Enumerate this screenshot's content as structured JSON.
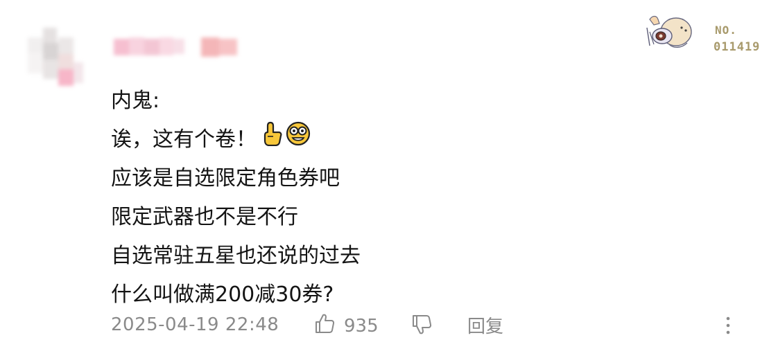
{
  "badge": {
    "prefix": "NO.",
    "number": "011419",
    "color": "#a89a6c"
  },
  "comment": {
    "lines": [
      "内鬼:",
      "诶，这有个卷！",
      "应该是自选限定角色券吧",
      "限定武器也不是不行",
      "自选常驻五星也还说的过去",
      "什么叫做满200减30券?"
    ],
    "emojis": [
      "pointing-up-hand-icon",
      "grinning-glasses-face-icon"
    ]
  },
  "footer": {
    "timestamp": "2025-04-19 22:48",
    "like_count": "935",
    "reply_label": "回复",
    "text_color": "#8a8a8a"
  },
  "icons": {
    "like": "thumbs-up-icon",
    "dislike": "thumbs-down-icon",
    "more": "more-vertical-icon"
  }
}
